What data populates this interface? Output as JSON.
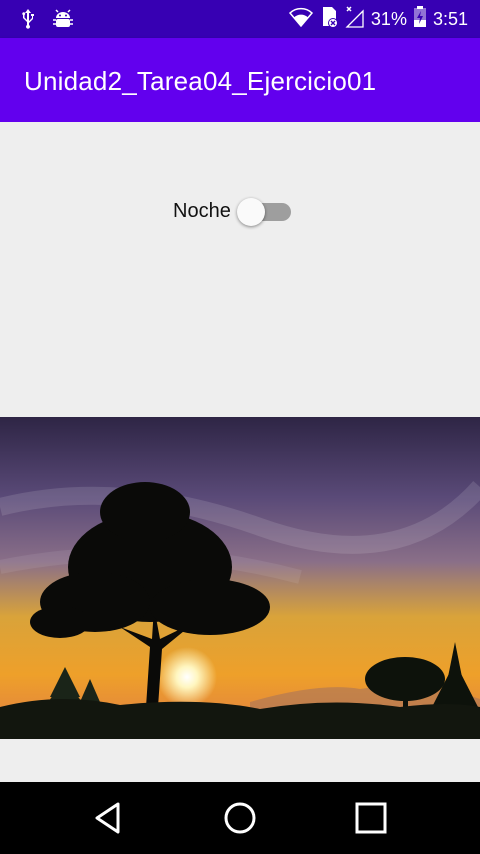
{
  "status_bar": {
    "battery_percent": "31%",
    "time": "3:51",
    "icons": [
      "usb-icon",
      "android-debug-icon",
      "wifi-icon",
      "sd-card-error-icon",
      "signal-no-sim-icon",
      "battery-charging-icon"
    ]
  },
  "app_bar": {
    "title": "Unidad2_Tarea04_Ejercicio01",
    "color": "#6200ee"
  },
  "main": {
    "switch": {
      "label": "Noche",
      "checked": false
    },
    "image": {
      "icon": "sunset-tree-landscape"
    }
  },
  "nav_bar": {
    "buttons": [
      "back-icon",
      "home-icon",
      "recents-icon"
    ]
  },
  "colors": {
    "status_bar": "#3700b3",
    "background": "#eeeeee",
    "switch_track": "#9e9e9e",
    "switch_thumb": "#fafafa"
  }
}
